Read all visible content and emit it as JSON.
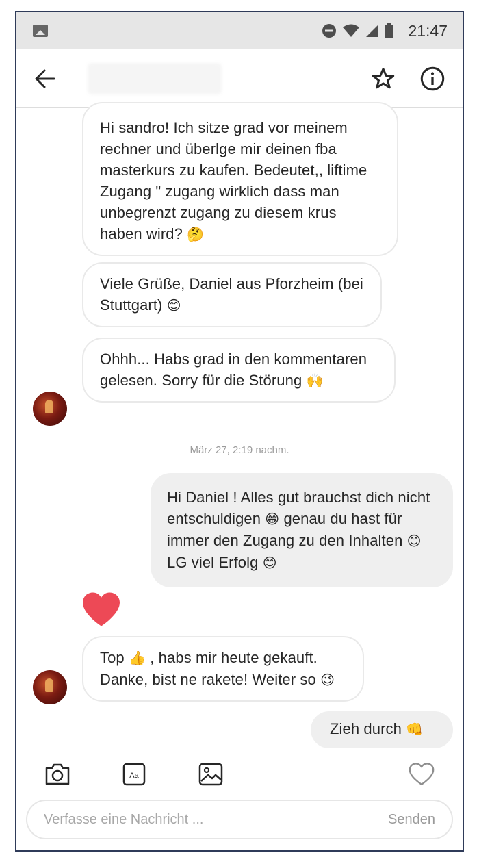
{
  "status_bar": {
    "time": "21:47",
    "icons": [
      "gallery-icon",
      "dnd-icon",
      "wifi-icon",
      "signal-icon",
      "battery-icon"
    ]
  },
  "header": {
    "icons": [
      "back-arrow-icon",
      "star-icon",
      "info-icon"
    ]
  },
  "messages": [
    {
      "direction": "incoming",
      "text": "Hi sandro! Ich sitze grad vor meinem rechner und überlge mir deinen fba masterkurs zu kaufen. Bedeutet,, liftime Zugang \" zugang wirklich dass man unbegrenzt zugang zu diesem krus haben wird?",
      "emoji": "🤔"
    },
    {
      "direction": "incoming",
      "text": "Viele Grüße, Daniel aus Pforzheim (bei Stuttgart)",
      "emoji": "😊"
    },
    {
      "direction": "incoming",
      "text": "Ohhh... Habs grad in den kommentaren gelesen. Sorry für die Störung",
      "emoji": "🙌"
    },
    {
      "direction": "outgoing",
      "text_parts": [
        "Hi Daniel ! Alles gut brauchst dich nicht entschuldigen",
        "genau du hast für immer den Zugang zu den Inhalten",
        "LG viel Erfolg"
      ],
      "emojis": [
        "😁",
        "😊",
        "😊"
      ]
    },
    {
      "direction": "incoming",
      "text_parts": [
        "Top",
        ", habs mir heute gekauft. Danke, bist ne rakete! Weiter so"
      ],
      "emojis": [
        "👍",
        "😉"
      ]
    },
    {
      "direction": "outgoing",
      "text": "Zieh durch",
      "emoji": "👊"
    }
  ],
  "timestamp": "März 27, 2:19 nachm.",
  "reaction": "heart",
  "colors": {
    "heart": "#ed4956",
    "outgoing_bubble": "#efefef",
    "incoming_border": "#e9e9e9",
    "frame_border": "#2f3b59"
  },
  "toolbar": {
    "icons": [
      "camera-icon",
      "text-style-icon",
      "gallery-image-icon",
      "heart-outline-icon"
    ],
    "text_style_label": "Aa"
  },
  "composer": {
    "placeholder": "Verfasse eine Nachricht ...",
    "send_label": "Senden"
  }
}
